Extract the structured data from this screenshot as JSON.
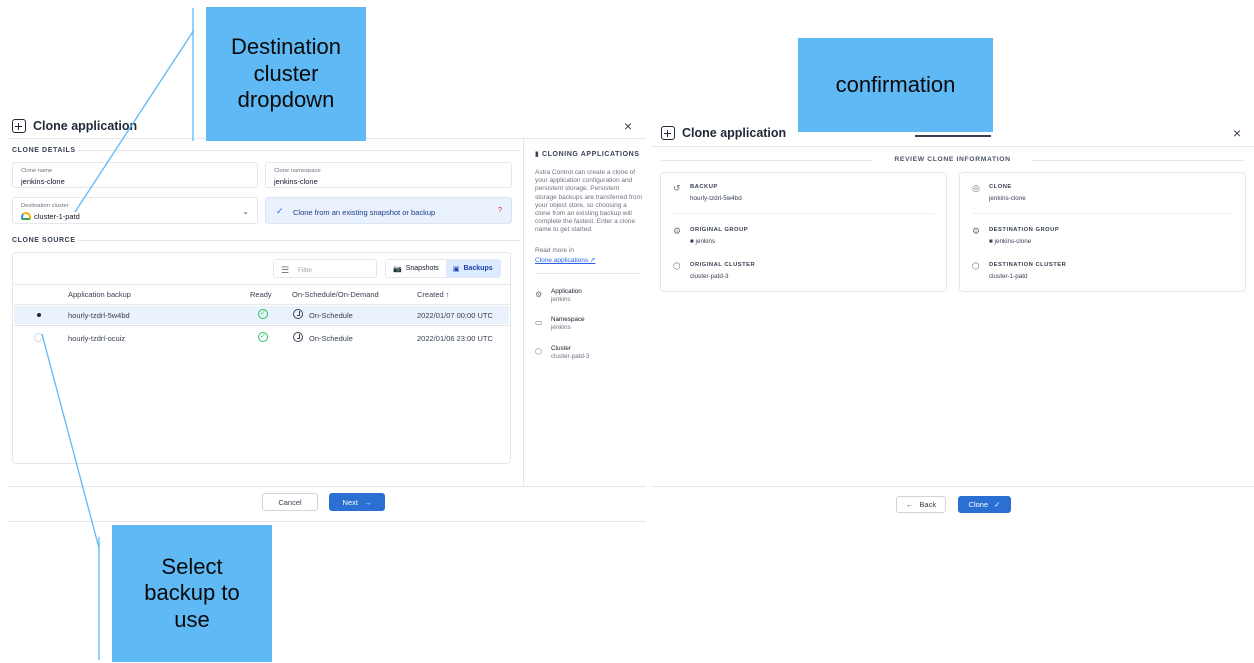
{
  "callouts": {
    "destination": "Destination\ncluster\ndropdown",
    "confirmation": "confirmation",
    "select_backup": "Select\nbackup to\nuse"
  },
  "clone_dialog": {
    "title": "Clone application",
    "close": "×",
    "clone_details_label": "CLONE DETAILS",
    "clone_name": {
      "label": "Clone name",
      "value": "jenkins-clone"
    },
    "clone_namespace": {
      "label": "Clone namespace",
      "value": "jenkins-clone"
    },
    "destination_cluster": {
      "label": "Destination cluster",
      "value": "cluster-1-patd"
    },
    "clone_from_snapshot": {
      "label": "Clone from an existing snapshot or backup",
      "checked": true
    },
    "clone_source_label": "CLONE SOURCE",
    "filter_placeholder": "Filter",
    "tabs": {
      "snapshots": "Snapshots",
      "backups": "Backups",
      "active": "backups"
    },
    "columns": {
      "backup": "Application backup",
      "ready": "Ready",
      "schedule": "On-Schedule/On-Demand",
      "created": "Created"
    },
    "sort_indicator": "↑",
    "rows": [
      {
        "name": "hourly-tzdrl-5w4bd",
        "schedule": "On-Schedule",
        "created": "2022/01/07 00:00 UTC",
        "selected": true
      },
      {
        "name": "hourly-tzdrl-ocuiz",
        "schedule": "On-Schedule",
        "created": "2022/01/06 23:00 UTC",
        "selected": false
      }
    ],
    "side": {
      "heading": "CLONING APPLICATIONS",
      "body": "Astra Control can create a clone of your application configuration and persistent storage. Persistent storage backups are transferred from your object store, so choosing a clone from an existing backup will complete the fastest. Enter a clone name to get started.",
      "read_more": "Read more in",
      "link": "Clone applications ↗",
      "application": {
        "key": "Application",
        "value": "jenkins"
      },
      "namespace": {
        "key": "Namespace",
        "value": "jenkins"
      },
      "cluster": {
        "key": "Cluster",
        "value": "cluster-patd-3"
      }
    },
    "cancel": "Cancel",
    "next": "Next",
    "next_arrow": "→"
  },
  "review_dialog": {
    "title": "Clone application",
    "close": "×",
    "heading": "REVIEW CLONE INFORMATION",
    "backup": {
      "key": "BACKUP",
      "value": "hourly-tzdrl-5w4bd"
    },
    "original_group": {
      "key": "ORIGINAL GROUP",
      "value": "■ jenkins"
    },
    "original_cluster": {
      "key": "ORIGINAL CLUSTER",
      "value": "cluster-patd-3"
    },
    "clone": {
      "key": "CLONE",
      "value": "jenkins-clone"
    },
    "destination_group": {
      "key": "DESTINATION GROUP",
      "value": "■ jenkins-clone"
    },
    "destination_cluster": {
      "key": "DESTINATION CLUSTER",
      "value": "cluster-1-patd"
    },
    "back": "Back",
    "back_arrow": "←",
    "clone_btn": "Clone",
    "clone_check": "✓"
  }
}
